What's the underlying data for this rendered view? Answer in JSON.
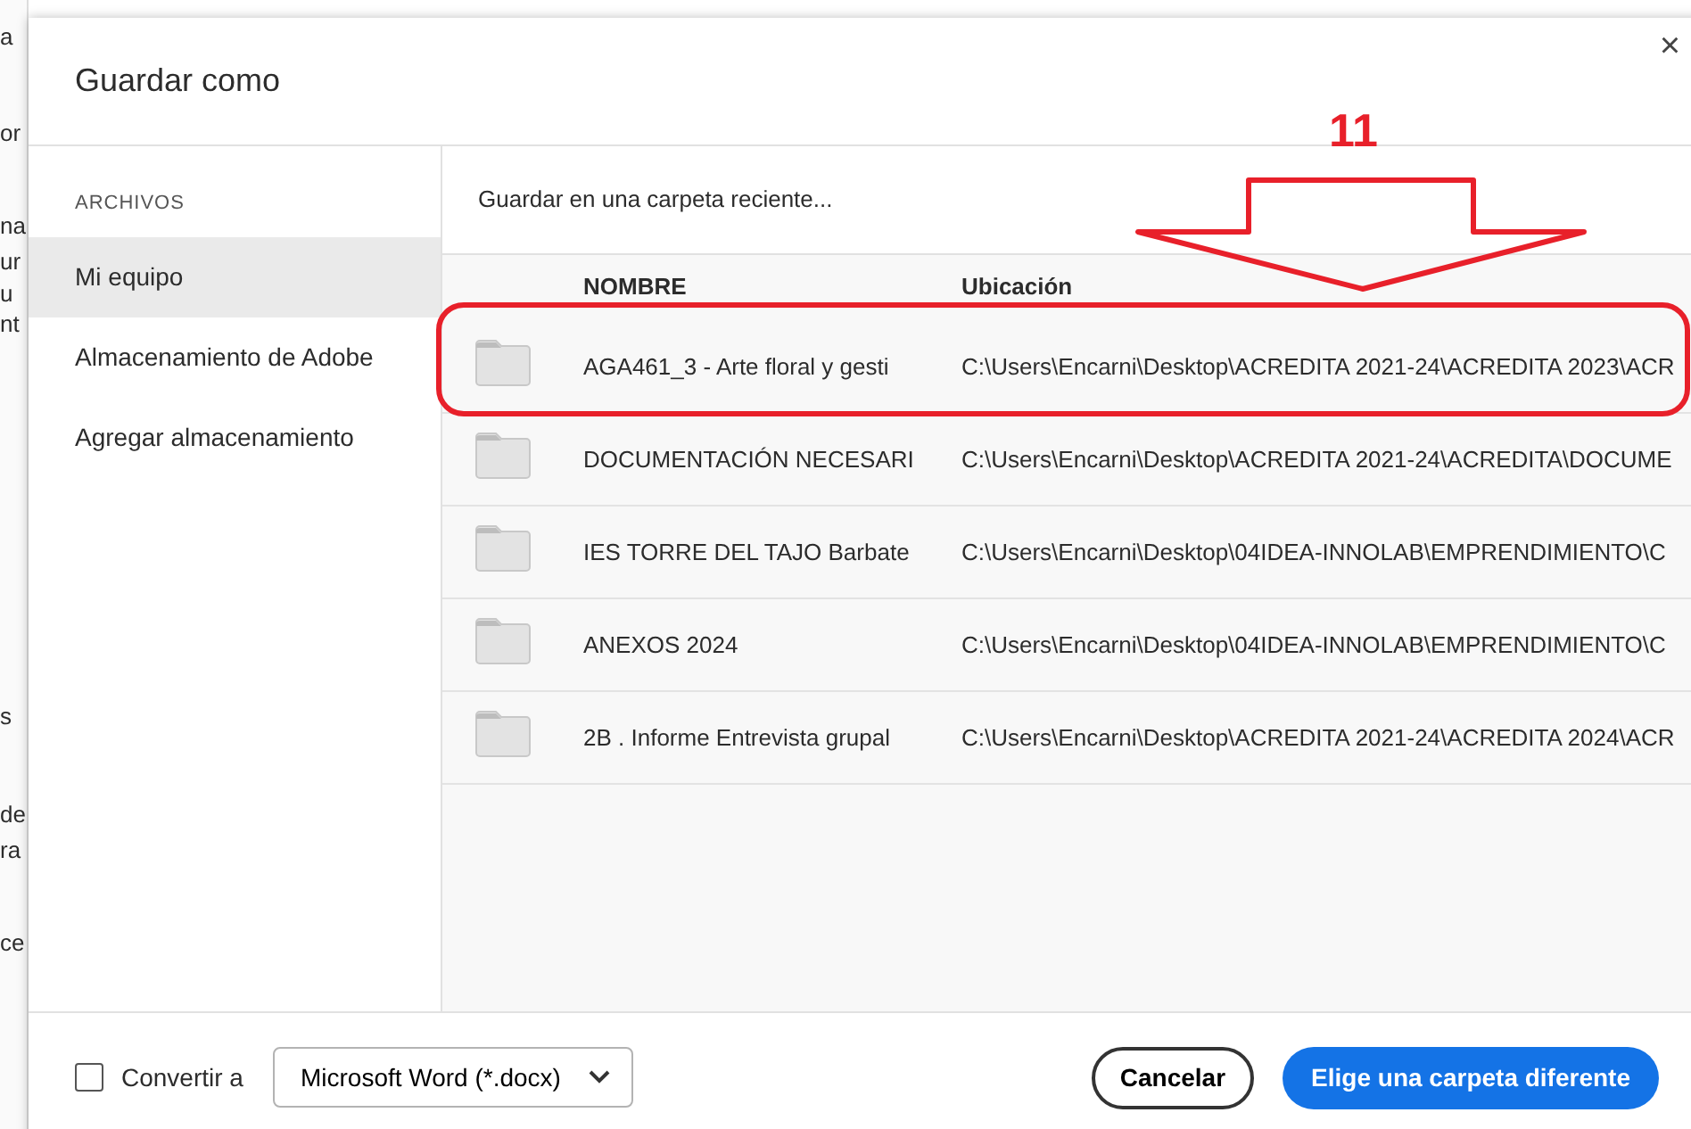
{
  "background_fragments": [
    "a",
    "or",
    "na",
    "ur",
    "u",
    "nt",
    "s",
    "de",
    "ra",
    "ce"
  ],
  "dialog": {
    "title": "Guardar como",
    "close": "×"
  },
  "sidebar": {
    "section": "ARCHIVOS",
    "items": [
      {
        "label": "Mi equipo",
        "selected": true
      },
      {
        "label": "Almacenamiento de Adobe",
        "selected": false
      },
      {
        "label": "Agregar almacenamiento",
        "selected": false
      }
    ]
  },
  "recent": {
    "heading": "Guardar en una carpeta reciente...",
    "columns": [
      "NOMBRE",
      "Ubicación"
    ],
    "rows": [
      {
        "name": "AGA461_3 - Arte floral y gesti",
        "location": "C:\\Users\\Encarni\\Desktop\\ACREDITA 2021-24\\ACREDITA 2023\\ACR"
      },
      {
        "name": "DOCUMENTACIÓN NECESARI",
        "location": "C:\\Users\\Encarni\\Desktop\\ACREDITA 2021-24\\ACREDITA\\DOCUME"
      },
      {
        "name": "IES TORRE DEL TAJO Barbate",
        "location": "C:\\Users\\Encarni\\Desktop\\04IDEA-INNOLAB\\EMPRENDIMIENTO\\C"
      },
      {
        "name": "ANEXOS 2024",
        "location": "C:\\Users\\Encarni\\Desktop\\04IDEA-INNOLAB\\EMPRENDIMIENTO\\C"
      },
      {
        "name": "2B . Informe Entrevista grupal",
        "location": "C:\\Users\\Encarni\\Desktop\\ACREDITA 2021-24\\ACREDITA 2024\\ACR"
      }
    ]
  },
  "annotation": {
    "label": "11"
  },
  "footer": {
    "convert": {
      "label": "Convertir a",
      "checked": false
    },
    "format": "Microsoft Word (*.docx)",
    "buttons": [
      {
        "label": "Cancelar",
        "kind": "secondary"
      },
      {
        "label": "Elige una carpeta diferente",
        "kind": "primary"
      }
    ]
  }
}
